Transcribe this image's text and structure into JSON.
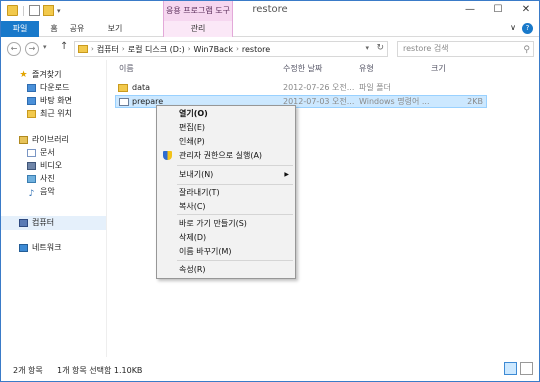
{
  "window": {
    "title": "restore",
    "controls": [
      "—",
      "☐",
      "✕"
    ]
  },
  "quick_access": {
    "icons": [
      "folder-icon",
      "document-icon",
      "new-folder-icon"
    ],
    "dropdown": "▾"
  },
  "ribbon": {
    "context_group": "응용 프로그램 도구",
    "tabs": {
      "file": "파일",
      "home": "홈",
      "share": "공유",
      "view": "보기",
      "manage": "관리"
    },
    "expand": "∨",
    "help": "?"
  },
  "nav": {
    "back": "←",
    "forward": "→",
    "history": "▾",
    "up": "↑",
    "breadcrumbs": [
      "컴퓨터",
      "로컬 디스크 (D:)",
      "Win7Back",
      "restore"
    ],
    "crumb_sep": "›",
    "address_dropdown": "▾",
    "refresh": "↻",
    "search_placeholder": "restore 검색",
    "search_icon": "⚲"
  },
  "navpane": {
    "favorites": "즐겨찾기",
    "favorites_items": [
      "다운로드",
      "바탕 화면",
      "최근 위치"
    ],
    "libraries": "라이브러리",
    "library_items": [
      "문서",
      "비디오",
      "사진",
      "음악"
    ],
    "computer": "컴퓨터",
    "network": "네트워크"
  },
  "filelist": {
    "columns": {
      "name": "이름",
      "date": "수정한 날짜",
      "type": "유형",
      "size": "크기"
    },
    "rows": [
      {
        "name": "data",
        "date": "2012-07-26 오전...",
        "type": "파일 폴더",
        "size": ""
      },
      {
        "name": "prepare",
        "date": "2012-07-03 오전...",
        "type": "Windows 명령어 ...",
        "size": "2KB"
      }
    ]
  },
  "context_menu": {
    "open": "열기(O)",
    "edit": "편집(E)",
    "print": "인쇄(P)",
    "run_as_admin": "관리자 권한으로 실행(A)",
    "send_to": "보내기(N)",
    "submenu_arrow": "▶",
    "cut": "잘라내기(T)",
    "copy": "복사(C)",
    "create_shortcut": "바로 가기 만들기(S)",
    "delete": "삭제(D)",
    "rename": "이름 바꾸기(M)",
    "properties": "속성(R)"
  },
  "status": {
    "item_count": "2개 항목",
    "selection": "1개 항목 선택함 1.10KB"
  }
}
